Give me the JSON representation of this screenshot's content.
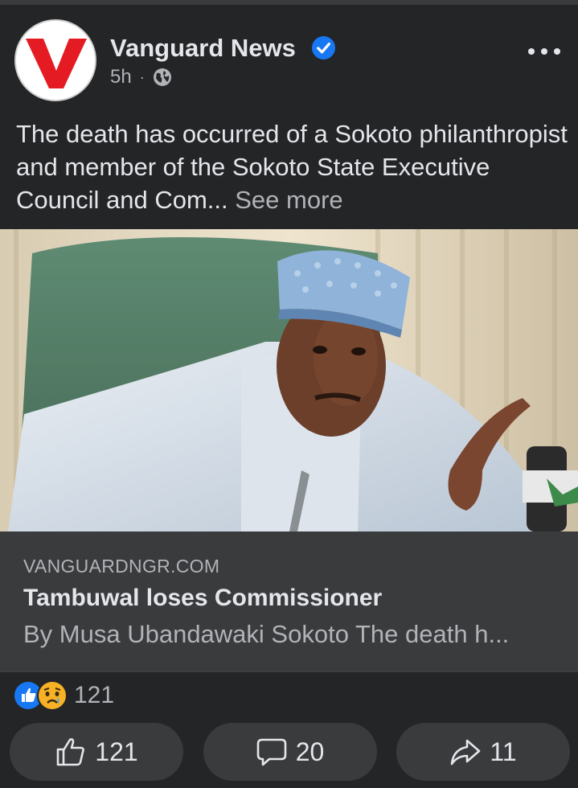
{
  "post": {
    "page_name": "Vanguard News",
    "time": "5h",
    "dot": "·",
    "audience_icon": "globe-icon",
    "text": "The death has occurred of a Sokoto philanthropist and member of the Sokoto State Executive Council and Com... ",
    "see_more": "See more"
  },
  "link": {
    "domain": "VANGUARDNGR.COM",
    "title": "Tambuwal loses Commissioner",
    "description": "By Musa Ubandawaki Sokoto The death h..."
  },
  "reactions": {
    "icons": [
      "like-icon",
      "sad-icon"
    ],
    "count": "121"
  },
  "actions": {
    "like_count": "121",
    "comment_count": "20",
    "share_count": "11"
  },
  "colors": {
    "background": "#242526",
    "card": "#3a3b3c",
    "text_primary": "#e4e6eb",
    "text_secondary": "#b0b3b8",
    "verified_blue": "#1877f2",
    "logo_red": "#e41b23"
  }
}
